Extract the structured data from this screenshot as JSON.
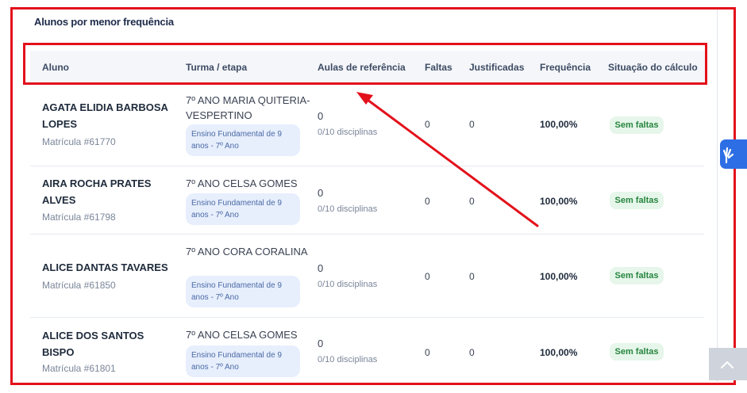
{
  "card_title": "Alunos por menor frequência",
  "columns": [
    "Aluno",
    "Turma / etapa",
    "Aulas de referência",
    "Faltas",
    "Justificadas",
    "Frequência",
    "Situação do cálculo"
  ],
  "rows": [
    {
      "name": "AGATA ELIDIA BARBOSA LOPES",
      "matricula": "Matrícula #61770",
      "turma": "7º ANO MARIA QUITERIA-VESPERTINO",
      "etapa": "Ensino Fundamental de 9 anos - 7º Ano",
      "aulas": "0",
      "disciplinas": "0/10 disciplinas",
      "faltas": "0",
      "justificadas": "0",
      "frequencia": "100,00%",
      "situacao": "Sem faltas"
    },
    {
      "name": "AIRA ROCHA PRATES ALVES",
      "matricula": "Matrícula #61798",
      "turma": "7º ANO CELSA GOMES",
      "etapa": "Ensino Fundamental de 9 anos - 7º Ano",
      "aulas": "0",
      "disciplinas": "0/10 disciplinas",
      "faltas": "0",
      "justificadas": "0",
      "frequencia": "100,00%",
      "situacao": "Sem faltas"
    },
    {
      "name": "ALICE DANTAS TAVARES",
      "matricula": "Matrícula #61850",
      "turma": "7º ANO CORA CORALINA",
      "etapa": "Ensino Fundamental de 9 anos - 7º Ano",
      "aulas": "0",
      "disciplinas": "0/10 disciplinas",
      "faltas": "0",
      "justificadas": "0",
      "frequencia": "100,00%",
      "situacao": "Sem faltas"
    },
    {
      "name": "ALICE DOS SANTOS BISPO",
      "matricula": "Matrícula #61801",
      "turma": "7º ANO CELSA GOMES",
      "etapa": "Ensino Fundamental de 9 anos - 7º Ano",
      "aulas": "0",
      "disciplinas": "0/10 disciplinas",
      "faltas": "0",
      "justificadas": "0",
      "frequencia": "100,00%",
      "situacao": "Sem faltas"
    }
  ],
  "icons": {
    "side_tab": "accessibility-hand-icon",
    "scroll_top": "chevron-up-icon"
  },
  "colors": {
    "annotation_red": "#e3111b",
    "badge_green": "#27853f",
    "badge_bg": "#e6f6ea",
    "chip_bg": "#e7eefc",
    "accent_blue": "#2d6ee4"
  }
}
